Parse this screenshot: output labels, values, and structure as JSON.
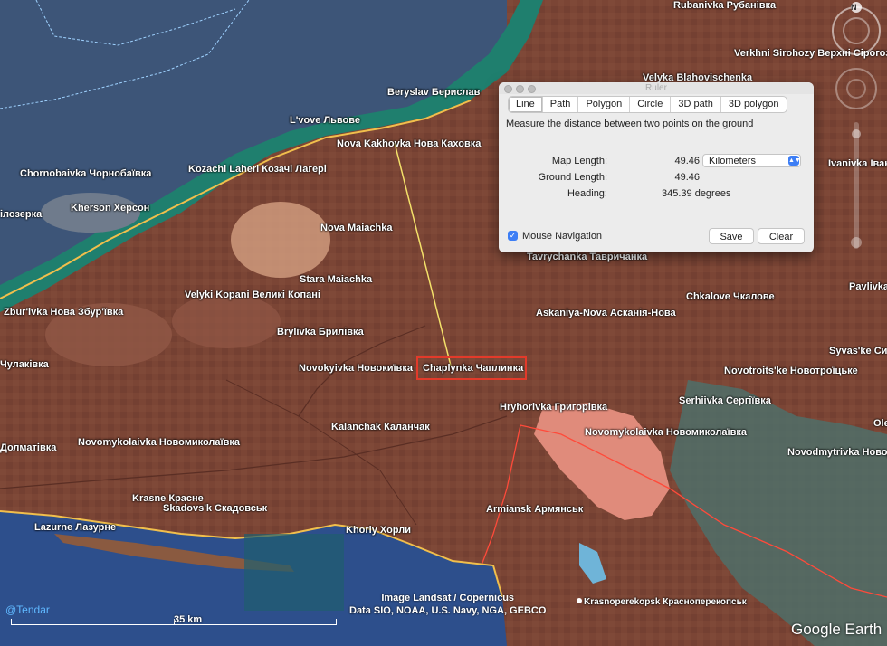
{
  "places": [
    {
      "name": "Rubanivka Рубанівка"
    },
    {
      "name": "Verkhni Sirohozy Верхні Сірогоз"
    },
    {
      "name": "Velyka Blahovischenka"
    },
    {
      "name": "Ivanivka Іван"
    },
    {
      "name": "Beryslav Берислав"
    },
    {
      "name": "L'vove Львове"
    },
    {
      "name": "Nova Kakhovka Нова Каховка"
    },
    {
      "name": "Chornobaivka Чорнобаївка"
    },
    {
      "name": "Kozachi Laheri Козачі Лагері"
    },
    {
      "name": "Kherson Херсон"
    },
    {
      "name": "ілозерка"
    },
    {
      "name": "Nova Maiachka"
    },
    {
      "name": "Stara Maiachka"
    },
    {
      "name": "Velyki Kopani Великі Копані"
    },
    {
      "name": "Zbur'ivka Нова Збур'ївка"
    },
    {
      "name": "Brylivka Брилівка"
    },
    {
      "name": "Чулаківка"
    },
    {
      "name": "Novokyivka Новокиївка"
    },
    {
      "name": "Chaplynka Чаплинка"
    },
    {
      "name": "Tavrychanka Тавричанка"
    },
    {
      "name": "Chkalove Чкалове"
    },
    {
      "name": "Pavlivka"
    },
    {
      "name": "Askaniya-Nova Асканія-Нова"
    },
    {
      "name": "Syvas'ke Си"
    },
    {
      "name": "Novotroits'ke Новотроїцьке"
    },
    {
      "name": "Serhiivka Сергіївка"
    },
    {
      "name": "Hryhorivka Григорівка"
    },
    {
      "name": "Ole"
    },
    {
      "name": "Kalanchak Каланчак"
    },
    {
      "name": "Novomykolaivka Новомиколаївка"
    },
    {
      "name": "Долматівка"
    },
    {
      "name": "Novomykolaivka Новомиколаївка"
    },
    {
      "name": "Novodmytrivka Новодм"
    },
    {
      "name": "Krasne Красне"
    },
    {
      "name": "Skadovs'k Скадовськ"
    },
    {
      "name": "Armiansk Армянськ"
    },
    {
      "name": "Lazurne Лазурне"
    },
    {
      "name": "Khorly Хорли"
    },
    {
      "name": "Krasnoperekopsk Красноперекопськ"
    },
    {
      "name": "Новомиколаївка"
    }
  ],
  "credits": {
    "line1": "Image Landsat / Copernicus",
    "line2": "Data SIO, NOAA, U.S. Navy, NGA, GEBCO"
  },
  "watermark": "@Tendar",
  "scale_label": "35 km",
  "logo": "Google Earth",
  "compass": "N",
  "ruler": {
    "title": "Ruler",
    "tabs": [
      "Line",
      "Path",
      "Polygon",
      "Circle",
      "3D path",
      "3D polygon"
    ],
    "selected_tab": "Line",
    "description": "Measure the distance between two points on the ground",
    "map_length_label": "Map Length:",
    "map_length_value": "49.46",
    "units": "Kilometers",
    "ground_length_label": "Ground Length:",
    "ground_length_value": "49.46",
    "heading_label": "Heading:",
    "heading_value": "345.39 degrees",
    "mouse_nav_label": "Mouse Navigation",
    "mouse_nav_checked": true,
    "save_label": "Save",
    "clear_label": "Clear"
  },
  "colors": {
    "land": "#7a4434",
    "water": "#3a5a86",
    "sea": "#2d4f8c",
    "border": "#f1bf4c",
    "ruler_line": "#f4e16a",
    "highlight": "#e33a2a"
  }
}
